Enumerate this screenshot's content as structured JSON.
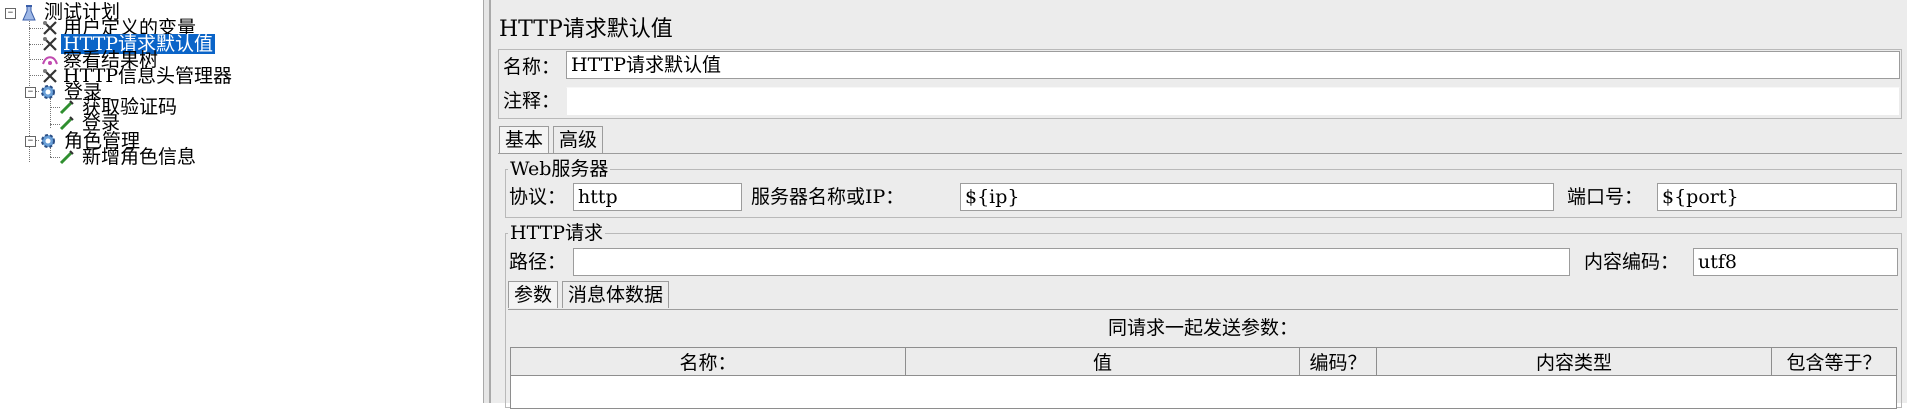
{
  "tree": {
    "root": {
      "label": "测试计划",
      "icon": "test-plan-icon"
    },
    "items": [
      {
        "label": "用户定义的变量",
        "icon": "wrench-icon"
      },
      {
        "label": "HTTP请求默认值",
        "icon": "wrench-icon",
        "selected": true
      },
      {
        "label": "察看结果树",
        "icon": "listener-icon"
      },
      {
        "label": "HTTP信息头管理器",
        "icon": "wrench-icon"
      },
      {
        "label": "登录",
        "icon": "gear-icon",
        "children": [
          {
            "label": "获取验证码",
            "icon": "pipette-icon"
          },
          {
            "label": "登录",
            "icon": "pipette-icon"
          }
        ]
      },
      {
        "label": "角色管理",
        "icon": "gear-icon",
        "children": [
          {
            "label": "新增角色信息",
            "icon": "pipette-icon"
          }
        ]
      }
    ]
  },
  "panel": {
    "title": "HTTP请求默认值",
    "name_label": "名称：",
    "name_value": "HTTP请求默认值",
    "comment_label": "注释：",
    "comment_value": "",
    "tabs": [
      "基本",
      "高级"
    ],
    "web_server": {
      "title": "Web服务器",
      "protocol_label": "协议：",
      "protocol_value": "http",
      "server_label": "服务器名称或IP：",
      "server_value": "${ip}",
      "port_label": "端口号：",
      "port_value": "${port}"
    },
    "http_request": {
      "title": "HTTP请求",
      "path_label": "路径：",
      "path_value": "",
      "encoding_label": "内容编码：",
      "encoding_value": "utf8",
      "subtabs": [
        "参数",
        "消息体数据"
      ],
      "params_caption": "同请求一起发送参数：",
      "columns": [
        "名称：",
        "值",
        "编码？",
        "内容类型",
        "包含等于？"
      ]
    }
  },
  "colors": {
    "selection": "#0a64c8",
    "panel_bg": "#ececec"
  }
}
